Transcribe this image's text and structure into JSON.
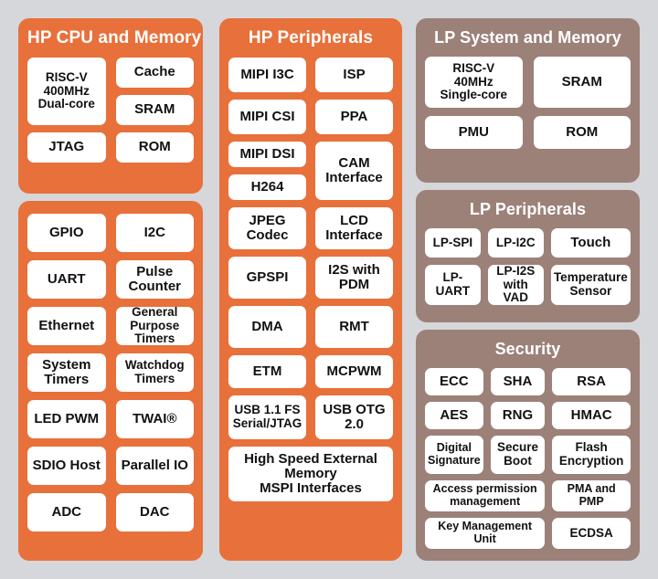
{
  "diagram": {
    "colors": {
      "background": "#d5d7da",
      "hp_panel": "#e8703a",
      "lp_panel": "#9c8179",
      "block_fill": "#ffffff",
      "block_text": "#111111",
      "panel_title_text": "#ffffff"
    }
  },
  "hp_cpu": {
    "title": "HP CPU and Memory",
    "blocks": [
      {
        "label": "RISC-V\n400MHz\nDual-core",
        "size": "sm"
      },
      {
        "label": "Cache",
        "size": "md"
      },
      {
        "label": "SRAM",
        "size": "md"
      },
      {
        "label": "JTAG",
        "size": "md"
      },
      {
        "label": "ROM",
        "size": "md"
      }
    ]
  },
  "hp_general": {
    "title": "",
    "blocks": [
      {
        "label": "GPIO",
        "size": "md"
      },
      {
        "label": "I2C",
        "size": "md"
      },
      {
        "label": "UART",
        "size": "md"
      },
      {
        "label": "Pulse\nCounter",
        "size": "md"
      },
      {
        "label": "Ethernet",
        "size": "md"
      },
      {
        "label": "General\nPurpose\nTimers",
        "size": "sm"
      },
      {
        "label": "System\nTimers",
        "size": "md"
      },
      {
        "label": "Watchdog\nTimers",
        "size": "sm"
      },
      {
        "label": "LED PWM",
        "size": "md"
      },
      {
        "label": "TWAI®",
        "size": "md"
      },
      {
        "label": "SDIO Host",
        "size": "md"
      },
      {
        "label": "Parallel IO",
        "size": "md"
      },
      {
        "label": "ADC",
        "size": "md"
      },
      {
        "label": "DAC",
        "size": "md"
      }
    ]
  },
  "hp_peripherals": {
    "title": "HP Peripherals",
    "blocks": [
      {
        "label": "MIPI I3C",
        "size": "md"
      },
      {
        "label": "ISP",
        "size": "md"
      },
      {
        "label": "MIPI CSI",
        "size": "md"
      },
      {
        "label": "PPA",
        "size": "md"
      },
      {
        "label": "MIPI DSI",
        "size": "md"
      },
      {
        "label": "CAM\nInterface",
        "size": "md"
      },
      {
        "label": "H264",
        "size": "md"
      },
      {
        "label": "JPEG\nCodec",
        "size": "md"
      },
      {
        "label": "LCD\nInterface",
        "size": "md"
      },
      {
        "label": "GPSPI",
        "size": "md"
      },
      {
        "label": "I2S with\nPDM",
        "size": "md"
      },
      {
        "label": "DMA",
        "size": "md"
      },
      {
        "label": "RMT",
        "size": "md"
      },
      {
        "label": "ETM",
        "size": "md"
      },
      {
        "label": "MCPWM",
        "size": "md"
      },
      {
        "label": "USB 1.1 FS\nSerial/JTAG",
        "size": "sm"
      },
      {
        "label": "USB OTG\n2.0",
        "size": "md"
      },
      {
        "label": "High Speed External\nMemory\nMSPI Interfaces",
        "size": "md"
      }
    ]
  },
  "lp_system": {
    "title": "LP System and Memory",
    "blocks": [
      {
        "label": "RISC-V\n40MHz\nSingle-core",
        "size": "sm"
      },
      {
        "label": "SRAM",
        "size": "md"
      },
      {
        "label": "PMU",
        "size": "md"
      },
      {
        "label": "ROM",
        "size": "md"
      }
    ]
  },
  "lp_peripherals": {
    "title": "LP Peripherals",
    "blocks": [
      {
        "label": "LP-SPI",
        "size": "sm"
      },
      {
        "label": "LP-I2C",
        "size": "sm"
      },
      {
        "label": "Touch",
        "size": "md"
      },
      {
        "label": "LP-UART",
        "size": "sm"
      },
      {
        "label": "LP-I2S\nwith\nVAD",
        "size": "sm"
      },
      {
        "label": "Temperature\nSensor",
        "size": "sm"
      }
    ]
  },
  "security": {
    "title": "Security",
    "blocks": [
      {
        "label": "ECC",
        "size": "md"
      },
      {
        "label": "SHA",
        "size": "md"
      },
      {
        "label": "RSA",
        "size": "md"
      },
      {
        "label": "AES",
        "size": "md"
      },
      {
        "label": "RNG",
        "size": "md"
      },
      {
        "label": "HMAC",
        "size": "md"
      },
      {
        "label": "Digital\nSignature",
        "size": "xs"
      },
      {
        "label": "Secure\nBoot",
        "size": "sm"
      },
      {
        "label": "Flash\nEncryption",
        "size": "sm"
      },
      {
        "label": "Access permission\nmanagement",
        "size": "xs"
      },
      {
        "label": "PMA and PMP",
        "size": "xs"
      },
      {
        "label": "Key Management\nUnit",
        "size": "xs"
      },
      {
        "label": "ECDSA",
        "size": "sm"
      }
    ]
  }
}
